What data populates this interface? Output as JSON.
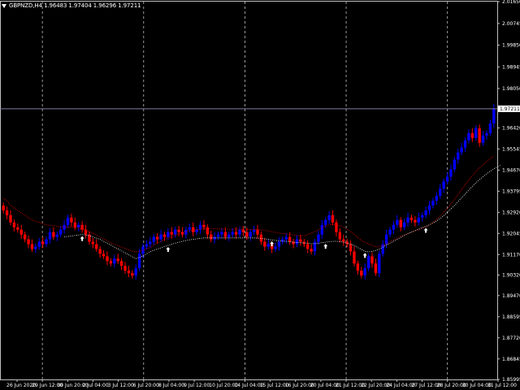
{
  "header": {
    "symbol": "GBPNZD,H4",
    "ohlc": "1.96483 1.97404 1.96296 1.97211"
  },
  "current_price_label": "1.97211",
  "colors": {
    "background": "#000000",
    "bull": "#0000ff",
    "bear": "#ff0000",
    "grid": "#c0c0c0",
    "price_line": "#8080a0",
    "upper_band": "#ff0000",
    "lower_band": "#ffffff",
    "text": "#ffffff"
  },
  "icons": {
    "menu": "triangle-down-icon",
    "signal": "up-arrow-icon"
  },
  "chart_data": {
    "type": "candlestick",
    "y_ticks": [
      "2.01650",
      "2.00745",
      "1.99850",
      "1.98945",
      "1.98050",
      "1.97145",
      "1.96420",
      "1.95545",
      "1.94670",
      "1.93795",
      "1.92920",
      "1.92045",
      "1.91170",
      "1.90320",
      "1.89470",
      "1.88595",
      "1.87720",
      "1.86845",
      "1.85995"
    ],
    "x_ticks": [
      "26 Jun 2020",
      "29 Jun 12:00",
      "30 Jun 20:00",
      "2 Jul 04:00",
      "3 Jul 12:00",
      "6 Jul 20:00",
      "8 Jul 04:00",
      "9 Jul 12:00",
      "10 Jul 20:00",
      "14 Jul 04:00",
      "15 Jul 12:00",
      "16 Jul 20:00",
      "20 Jul 04:00",
      "21 Jul 12:00",
      "22 Jul 20:00",
      "24 Jul 04:00",
      "27 Jul 12:00",
      "28 Jul 20:00",
      "30 Jul 04:00",
      "31 Jul 12:00"
    ],
    "ylim": [
      1.85995,
      2.0165
    ],
    "grid": true,
    "current_price": 1.97211,
    "close": [
      1.93,
      1.928,
      1.925,
      1.923,
      1.922,
      1.92,
      1.918,
      1.916,
      1.914,
      1.915,
      1.917,
      1.916,
      1.918,
      1.921,
      1.919,
      1.92,
      1.922,
      1.924,
      1.927,
      1.925,
      1.923,
      1.924,
      1.922,
      1.92,
      1.917,
      1.916,
      1.914,
      1.912,
      1.911,
      1.909,
      1.908,
      1.91,
      1.909,
      1.907,
      1.905,
      1.904,
      1.903,
      1.906,
      1.912,
      1.915,
      1.916,
      1.917,
      1.919,
      1.918,
      1.92,
      1.919,
      1.921,
      1.92,
      1.922,
      1.921,
      1.92,
      1.922,
      1.923,
      1.921,
      1.922,
      1.924,
      1.923,
      1.92,
      1.918,
      1.919,
      1.92,
      1.921,
      1.919,
      1.92,
      1.921,
      1.92,
      1.922,
      1.921,
      1.919,
      1.921,
      1.922,
      1.92,
      1.917,
      1.915,
      1.916,
      1.914,
      1.915,
      1.917,
      1.918,
      1.919,
      1.917,
      1.916,
      1.918,
      1.917,
      1.916,
      1.914,
      1.913,
      1.917,
      1.92,
      1.924,
      1.926,
      1.928,
      1.925,
      1.921,
      1.918,
      1.917,
      1.916,
      1.913,
      1.908,
      1.905,
      1.903,
      1.906,
      1.911,
      1.908,
      1.904,
      1.912,
      1.916,
      1.92,
      1.922,
      1.924,
      1.926,
      1.923,
      1.925,
      1.927,
      1.926,
      1.925,
      1.927,
      1.928,
      1.93,
      1.932,
      1.934,
      1.936,
      1.939,
      1.942,
      1.944,
      1.947,
      1.951,
      1.954,
      1.956,
      1.959,
      1.962,
      1.96,
      1.964,
      1.958,
      1.961,
      1.962,
      1.966,
      1.9721
    ],
    "upper_band": [
      1.935,
      1.934,
      1.932,
      1.931,
      1.93,
      1.929,
      1.928,
      1.927,
      1.926,
      1.9255,
      1.925,
      1.9245,
      1.924,
      1.9238,
      1.9236,
      1.9234,
      1.9232,
      1.923,
      1.923,
      1.923,
      1.9228,
      1.9226,
      1.9222,
      1.9218,
      1.9212,
      1.9205,
      1.9198,
      1.919,
      1.9182,
      1.9174,
      1.9166,
      1.916,
      1.9154,
      1.9148,
      1.9142,
      1.9136,
      1.913,
      1.9128,
      1.913,
      1.9135,
      1.914,
      1.9148,
      1.9156,
      1.9164,
      1.9172,
      1.918,
      1.9186,
      1.9192,
      1.9198,
      1.9204,
      1.9208,
      1.9212,
      1.9216,
      1.9218,
      1.922,
      1.9222,
      1.9224,
      1.9224,
      1.9224,
      1.9224,
      1.9223,
      1.9223,
      1.9222,
      1.9222,
      1.9222,
      1.9222,
      1.9222,
      1.9222,
      1.9221,
      1.9221,
      1.9221,
      1.922,
      1.9219,
      1.9217,
      1.9215,
      1.9212,
      1.9209,
      1.9206,
      1.9204,
      1.9202,
      1.92,
      1.9198,
      1.9196,
      1.9195,
      1.9195,
      1.92,
      1.9205,
      1.9212,
      1.922,
      1.9228,
      1.9235,
      1.924,
      1.9242,
      1.924,
      1.9236,
      1.923,
      1.9222,
      1.9212,
      1.92,
      1.9188,
      1.9176,
      1.9168,
      1.9162,
      1.9155,
      1.9148,
      1.915,
      1.9155,
      1.9162,
      1.917,
      1.9178,
      1.9186,
      1.9192,
      1.9198,
      1.9204,
      1.921,
      1.9215,
      1.922,
      1.9226,
      1.9232,
      1.924,
      1.925,
      1.9262,
      1.9276,
      1.9292,
      1.9308,
      1.9326,
      1.9346,
      1.9366,
      1.9386,
      1.9406,
      1.9426,
      1.9444,
      1.9462,
      1.9476,
      1.949,
      1.9502,
      1.9514,
      1.9526
    ],
    "lower_band": [
      null,
      null,
      null,
      null,
      null,
      null,
      null,
      null,
      null,
      null,
      null,
      null,
      null,
      null,
      null,
      null,
      null,
      1.919,
      1.9192,
      1.9194,
      1.9196,
      1.9198,
      1.92,
      1.9198,
      1.9195,
      1.919,
      1.9185,
      1.918,
      1.9172,
      1.9164,
      1.9156,
      1.9148,
      1.914,
      1.9132,
      1.9124,
      1.9116,
      1.9108,
      1.91,
      1.9105,
      1.9112,
      1.912,
      1.9128,
      1.9134,
      1.914,
      1.9145,
      1.915,
      1.9155,
      1.916,
      1.9164,
      1.9168,
      1.9172,
      1.9175,
      1.9178,
      1.918,
      1.9182,
      1.9184,
      1.9186,
      1.9186,
      1.9186,
      1.9186,
      1.9186,
      1.9186,
      1.9186,
      1.9186,
      1.9186,
      1.9186,
      1.9186,
      1.9186,
      1.9186,
      1.9186,
      1.9186,
      1.9185,
      1.9184,
      1.9182,
      1.918,
      1.9178,
      1.9176,
      1.9174,
      1.9173,
      1.9172,
      1.917,
      1.9168,
      1.9167,
      1.9166,
      1.9165,
      1.9164,
      1.9162,
      1.9162,
      1.9164,
      1.9166,
      1.9168,
      1.917,
      1.9172,
      1.9172,
      1.917,
      1.9168,
      1.9164,
      1.916,
      1.9154,
      1.9146,
      1.9138,
      1.913,
      1.9128,
      1.913,
      1.9134,
      1.914,
      1.9148,
      1.9156,
      1.9164,
      1.9172,
      1.918,
      1.9188,
      1.9196,
      1.9204,
      1.921,
      1.9216,
      1.9222,
      1.9228,
      1.9234,
      1.924,
      1.9248,
      1.9256,
      1.9266,
      1.9278,
      1.9292,
      1.9306,
      1.932,
      1.9336,
      1.9352,
      1.9368,
      1.9384,
      1.94,
      1.9414,
      1.9428,
      1.944,
      1.9452,
      1.9462,
      1.9472,
      1.948,
      1.9488
    ],
    "signal_arrows": [
      22,
      46,
      75,
      90,
      101,
      118
    ]
  }
}
